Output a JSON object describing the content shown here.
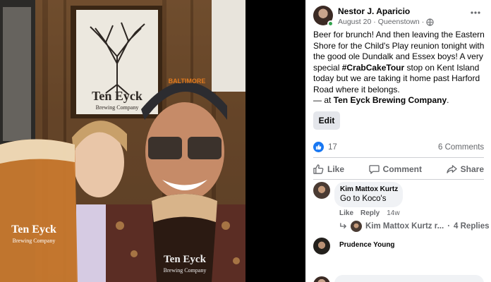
{
  "photo": {
    "sign_name": "Ten Eyck",
    "sign_subtitle": "Brewing Company",
    "glass_left_text": "Ten Eyck",
    "glass_left_sub": "Brewing Company",
    "glass_right_text": "Ten Eyck",
    "glass_right_sub": "Brewing Company",
    "cap_text": "BALTIMORE"
  },
  "post": {
    "author": "Nestor J. Aparicio",
    "date": "August 20",
    "separator": "·",
    "location": "Queenstown",
    "separator2": "·",
    "text_before_tag": "Beer for brunch! And then leaving the Eastern Shore for the Child's Play reunion tonight with the good ole Dundalk and Essex boys! A very special ",
    "hashtag": "#CrabCakeTour",
    "text_after_tag": " stop on Kent Island today but we are taking it home past Harford Road where it belongs.",
    "checkin_prefix": "— at ",
    "checkin_place": "Ten Eyck Brewing Company",
    "checkin_suffix": ".",
    "edit_label": "Edit",
    "reaction_count": "17",
    "comment_count": "6 Comments",
    "actions": {
      "like": "Like",
      "comment": "Comment",
      "share": "Share"
    }
  },
  "comments": [
    {
      "name": "Kim Mattox Kurtz",
      "text": "Go to Koco's",
      "like": "Like",
      "reply": "Reply",
      "time": "14w",
      "replies_author": "Kim Mattox Kurtz r...",
      "replies_separator": "·",
      "replies_count": "4 Replies"
    },
    {
      "name": "Prudence Young"
    }
  ],
  "colors": {
    "accent": "#1877f2",
    "text_secondary": "#65676b",
    "bubble": "#f0f2f5",
    "online": "#31a24c"
  }
}
